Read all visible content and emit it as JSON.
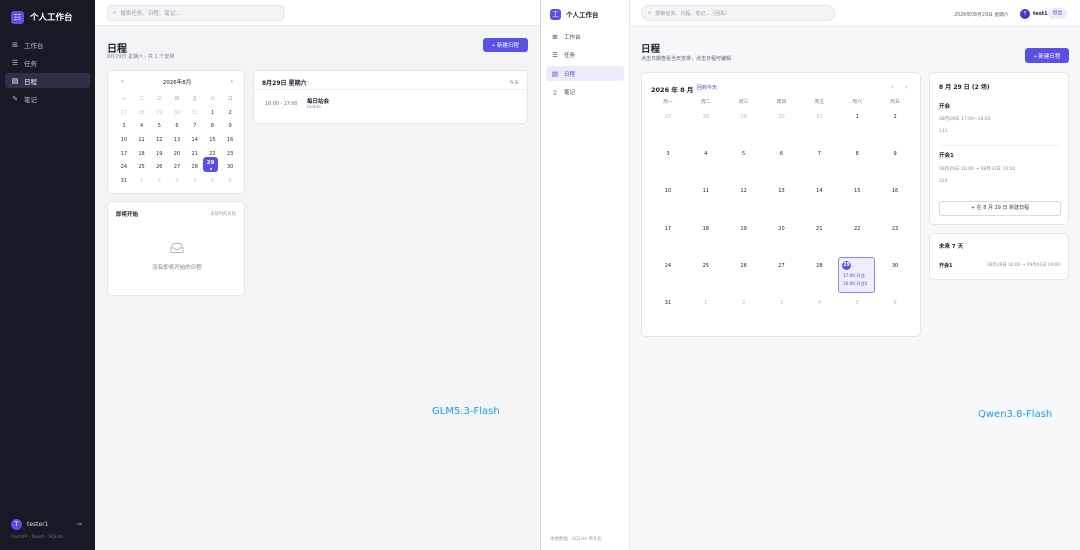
{
  "left": {
    "brand": {
      "title": "个人工作台",
      "logo_glyph": "☷"
    },
    "nav": [
      {
        "label": "工作台",
        "icon": "dashboard-icon",
        "glyph": "⊞"
      },
      {
        "label": "任务",
        "icon": "task-list-icon",
        "glyph": "☰"
      },
      {
        "label": "日程",
        "icon": "calendar-icon",
        "glyph": "▤",
        "active": true
      },
      {
        "label": "笔记",
        "icon": "note-icon",
        "glyph": "✎"
      }
    ],
    "user": {
      "avatar_letter": "T",
      "name": "tester1"
    },
    "footer": "FastAPI · React · SQLite",
    "search_placeholder": "搜索任务、日程、笔记...",
    "page_title": "日程",
    "page_subtitle": "8月29日 星期六 · 共 1 个安排",
    "new_button": "+ 新建日程",
    "mini_calendar": {
      "month": "2026年8月",
      "weekdays": [
        "一",
        "二",
        "三",
        "四",
        "五",
        "六",
        "日"
      ],
      "days": [
        {
          "d": "27",
          "dim": true
        },
        {
          "d": "28",
          "dim": true
        },
        {
          "d": "29",
          "dim": true
        },
        {
          "d": "30",
          "dim": true
        },
        {
          "d": "31",
          "dim": true
        },
        {
          "d": "1"
        },
        {
          "d": "2"
        },
        {
          "d": "3"
        },
        {
          "d": "4"
        },
        {
          "d": "5"
        },
        {
          "d": "6"
        },
        {
          "d": "7"
        },
        {
          "d": "8"
        },
        {
          "d": "9"
        },
        {
          "d": "10"
        },
        {
          "d": "11"
        },
        {
          "d": "12"
        },
        {
          "d": "13"
        },
        {
          "d": "14"
        },
        {
          "d": "15"
        },
        {
          "d": "16"
        },
        {
          "d": "17"
        },
        {
          "d": "18"
        },
        {
          "d": "19"
        },
        {
          "d": "20"
        },
        {
          "d": "21"
        },
        {
          "d": "22"
        },
        {
          "d": "23"
        },
        {
          "d": "24"
        },
        {
          "d": "25"
        },
        {
          "d": "26"
        },
        {
          "d": "27"
        },
        {
          "d": "28"
        },
        {
          "d": "29",
          "selected": true
        },
        {
          "d": "30"
        },
        {
          "d": "31"
        },
        {
          "d": "1",
          "dim": true
        },
        {
          "d": "2",
          "dim": true
        },
        {
          "d": "3",
          "dim": true
        },
        {
          "d": "4",
          "dim": true
        },
        {
          "d": "5",
          "dim": true
        },
        {
          "d": "6",
          "dim": true
        }
      ],
      "selected_day": "29"
    },
    "day_panel": {
      "title": "8月29日 星期六",
      "today_link": "今天",
      "event": {
        "time": "16:00 - 17:00",
        "name": "每日站会",
        "note": "blabla"
      }
    },
    "upcoming": {
      "title": "即将开始",
      "link": "未按时的日程",
      "empty_text": "没有即将开始的日程"
    },
    "watermark": "GLM5.3-Flash"
  },
  "right": {
    "brand": {
      "title": "个人工作台",
      "logo_glyph": "工"
    },
    "nav": [
      {
        "label": "工作台",
        "icon": "dashboard-icon",
        "glyph": "⊞"
      },
      {
        "label": "任务",
        "icon": "task-list-icon",
        "glyph": "☰"
      },
      {
        "label": "日程",
        "icon": "calendar-icon",
        "glyph": "▤",
        "active": true
      },
      {
        "label": "笔记",
        "icon": "note-icon",
        "glyph": "▯"
      }
    ],
    "footer": "本地数据 · SQLite 持久化",
    "search_placeholder": "搜索任务、日程、笔记...（回车）",
    "date_text": "2026年08月29日 星期六",
    "user": {
      "avatar_letter": "T",
      "name": "test1"
    },
    "logout": "退出",
    "page_title": "日程",
    "page_subtitle": "点击日期查看当天安排，点击日程可编辑",
    "new_button": "+ 新建日程",
    "calendar": {
      "month": "2026 年 8 月",
      "back_today": "回到今天",
      "weekdays": [
        "周一",
        "周二",
        "周三",
        "周四",
        "周五",
        "周六",
        "周日"
      ],
      "days": [
        {
          "d": "27",
          "dim": true
        },
        {
          "d": "28",
          "dim": true
        },
        {
          "d": "29",
          "dim": true
        },
        {
          "d": "30",
          "dim": true
        },
        {
          "d": "31",
          "dim": true
        },
        {
          "d": "1"
        },
        {
          "d": "2"
        },
        {
          "d": "3"
        },
        {
          "d": "4"
        },
        {
          "d": "5"
        },
        {
          "d": "6"
        },
        {
          "d": "7"
        },
        {
          "d": "8"
        },
        {
          "d": "9"
        },
        {
          "d": "10"
        },
        {
          "d": "11"
        },
        {
          "d": "12"
        },
        {
          "d": "13"
        },
        {
          "d": "14"
        },
        {
          "d": "15"
        },
        {
          "d": "16"
        },
        {
          "d": "17"
        },
        {
          "d": "18"
        },
        {
          "d": "19"
        },
        {
          "d": "20"
        },
        {
          "d": "21"
        },
        {
          "d": "22"
        },
        {
          "d": "23"
        },
        {
          "d": "24"
        },
        {
          "d": "25"
        },
        {
          "d": "26"
        },
        {
          "d": "27"
        },
        {
          "d": "28"
        },
        {
          "d": "29",
          "selected": true
        },
        {
          "d": "30"
        },
        {
          "d": "31"
        },
        {
          "d": "1",
          "dim": true
        },
        {
          "d": "2",
          "dim": true
        },
        {
          "d": "3",
          "dim": true
        },
        {
          "d": "4",
          "dim": true
        },
        {
          "d": "5",
          "dim": true
        },
        {
          "d": "6",
          "dim": true
        }
      ],
      "selected_day": "29",
      "selected_events": [
        "17:00 开会",
        "16:00 开会1"
      ]
    },
    "detail": {
      "title": "8 月 29 日 (2 场)",
      "events": [
        {
          "name": "开会",
          "time": "08月29日 17:00~18:00",
          "note": "111"
        },
        {
          "name": "开会1",
          "time": "08月29日 16:00 → 08月31日 19:00",
          "note": "222"
        }
      ],
      "new_button": "+ 在 8 月 29 日 新建日程"
    },
    "next7": {
      "title": "未来 7 天",
      "item": {
        "name": "开会1",
        "time": "08月29日 16:00 → 09月01日 19:00"
      }
    },
    "watermark": "Qwen3.8-Flash"
  },
  "colors": {
    "accent": "#5b50e6",
    "dark_sidebar": "#171a25",
    "watermark": "#1ba0e8"
  }
}
